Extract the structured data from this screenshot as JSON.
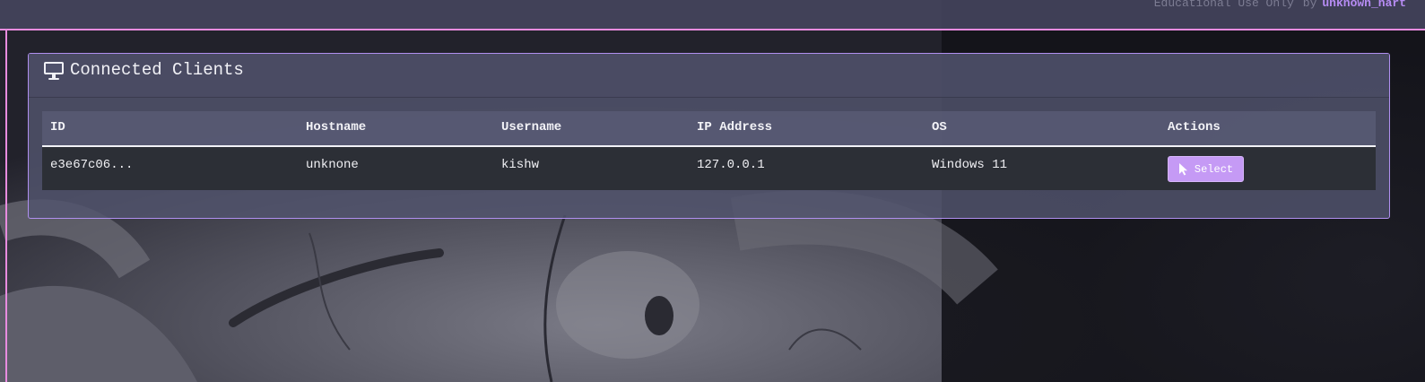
{
  "header": {
    "notice": "Educational Use Only",
    "by_label": "by",
    "author": "unknown_hart"
  },
  "panel": {
    "title": "Connected Clients",
    "icon": "monitor-icon"
  },
  "table": {
    "columns": [
      "ID",
      "Hostname",
      "Username",
      "IP Address",
      "OS",
      "Actions"
    ],
    "rows": [
      {
        "id": "e3e67c06...",
        "hostname": "unknone",
        "username": "kishw",
        "ip": "127.0.0.1",
        "os": "Windows 11",
        "action_label": "Select",
        "action_icon": "cursor-icon"
      }
    ]
  },
  "colors": {
    "accent_pink": "#e88cdf",
    "accent_purple": "#b78cf4",
    "button": "#c59af5"
  }
}
